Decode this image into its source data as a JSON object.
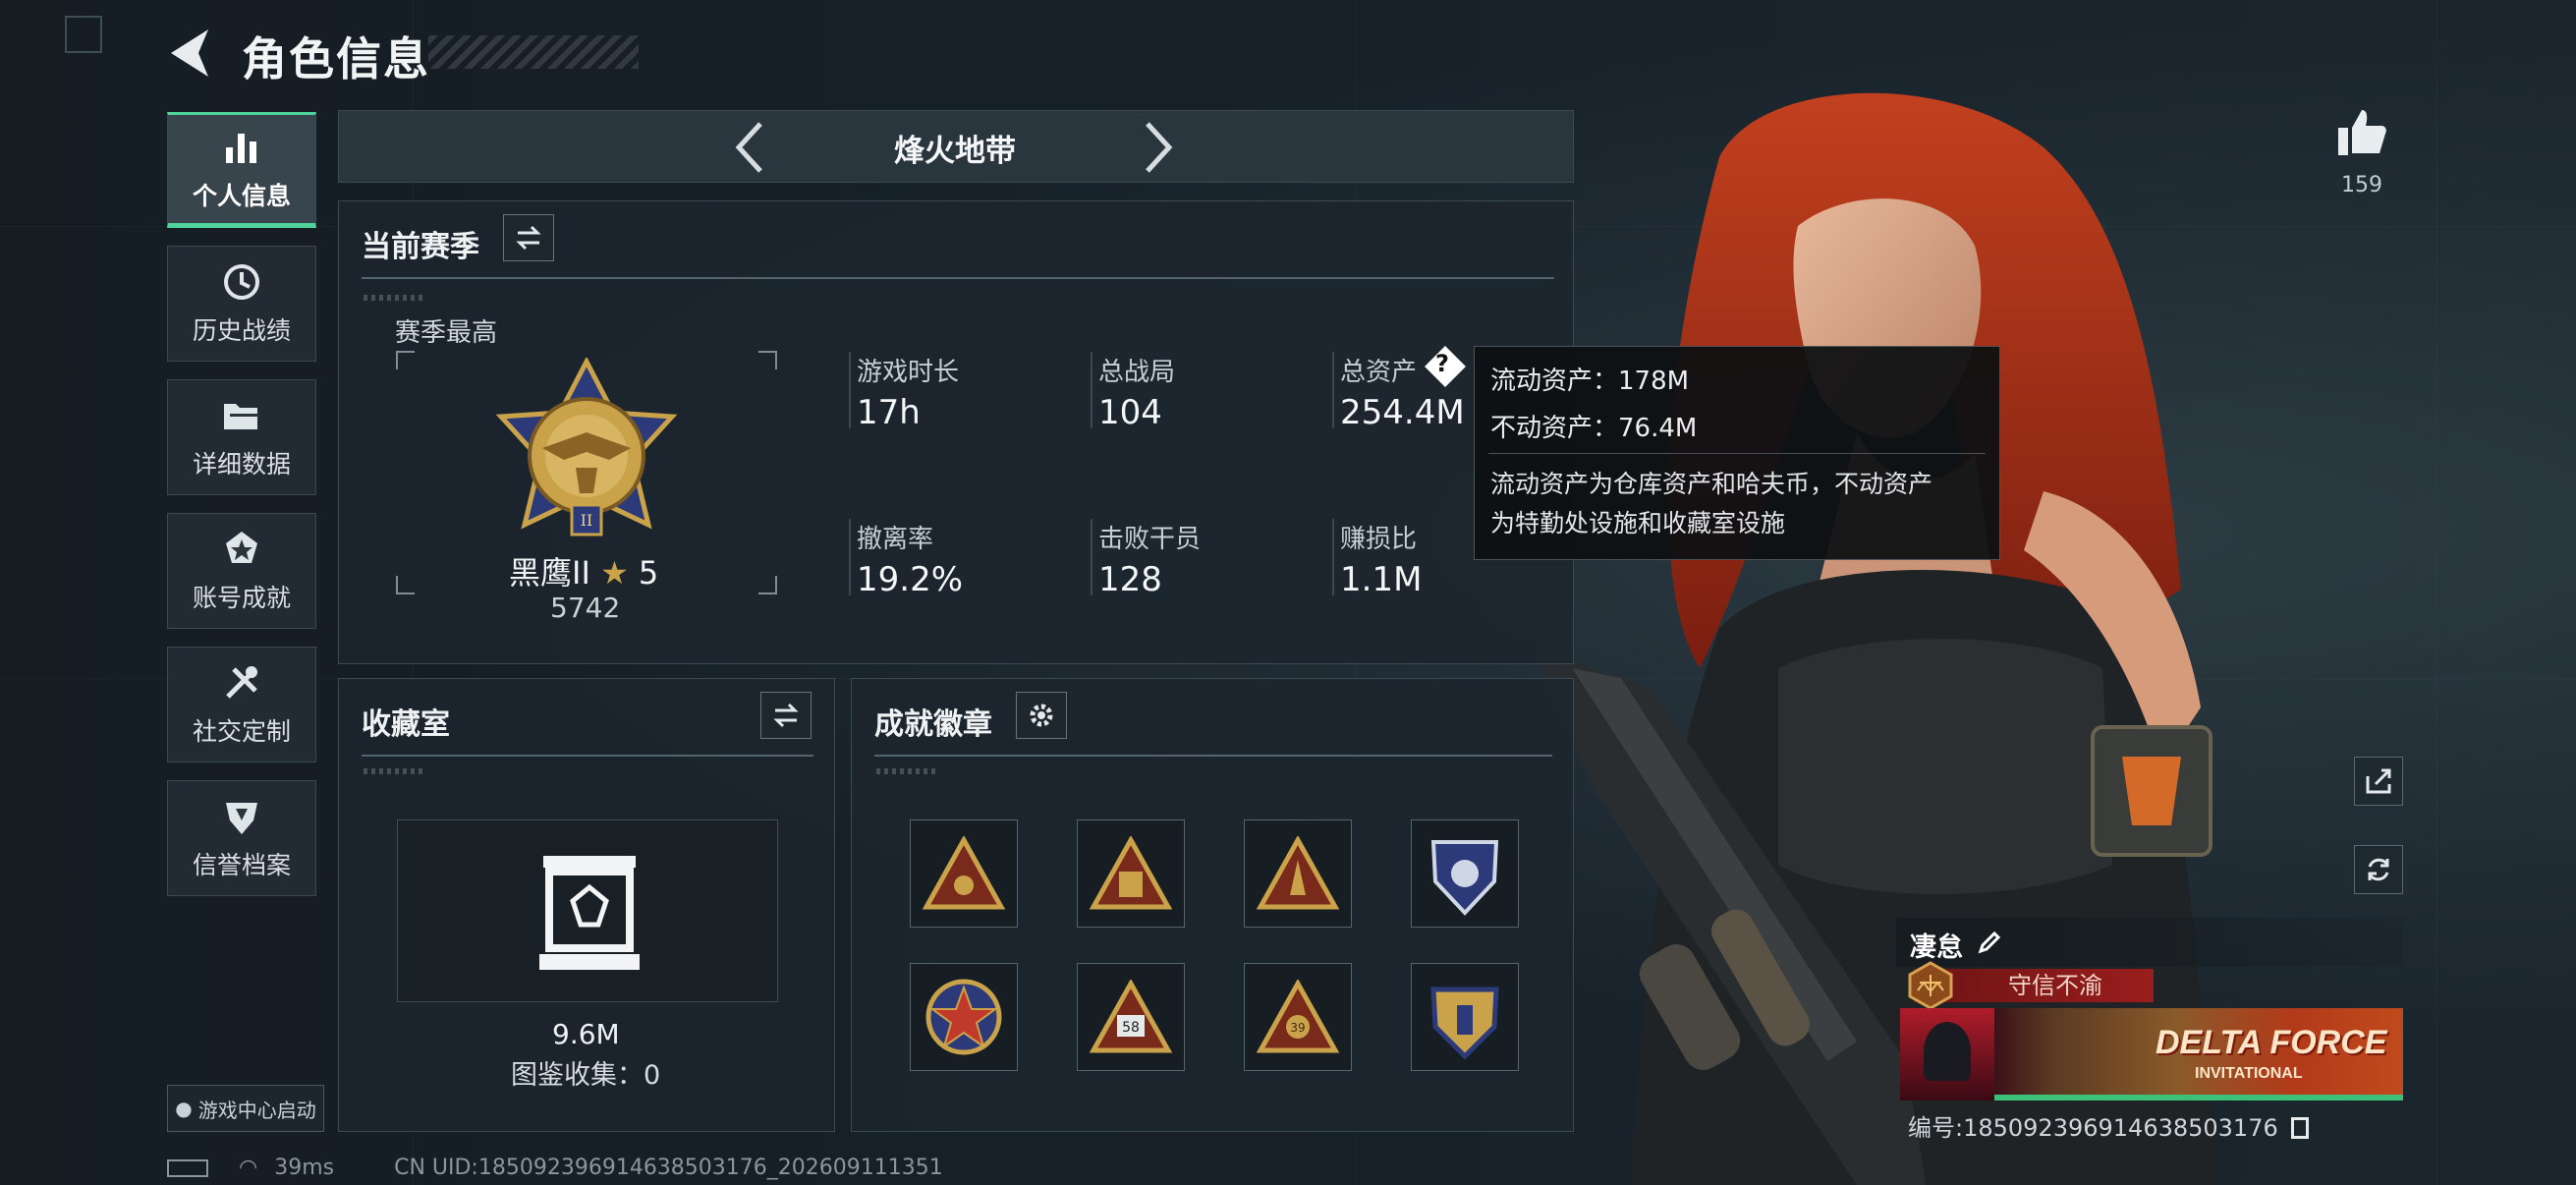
{
  "header": {
    "title": "角色信息"
  },
  "sidebar": {
    "items": [
      {
        "label": "个人信息",
        "icon": "bar-chart-icon",
        "active": true
      },
      {
        "label": "历史战绩",
        "icon": "clock-icon"
      },
      {
        "label": "详细数据",
        "icon": "folder-icon"
      },
      {
        "label": "账号成就",
        "icon": "medal-icon"
      },
      {
        "label": "社交定制",
        "icon": "tools-icon"
      },
      {
        "label": "信誉档案",
        "icon": "shield-icon"
      }
    ],
    "launch_button": "游戏中心启动"
  },
  "mode": {
    "name": "烽火地带"
  },
  "season": {
    "title": "当前赛季",
    "best_label": "赛季最高",
    "rank_name": "黑鹰II",
    "rank_stars": "5",
    "rank_score": "5742",
    "stats": [
      {
        "label": "游戏时长",
        "value": "17h"
      },
      {
        "label": "总战局",
        "value": "104"
      },
      {
        "label": "总资产",
        "value": "254.4M"
      },
      {
        "label": "撤离率",
        "value": "19.2%"
      },
      {
        "label": "击败干员",
        "value": "128"
      },
      {
        "label": "赚损比",
        "value": "1.1M"
      }
    ]
  },
  "tooltip": {
    "line1": "流动资产：178M",
    "line2": "不动资产：76.4M",
    "note_line1": "流动资产为仓库资产和哈夫币，不动资产",
    "note_line2": "为特勤处设施和收藏室设施"
  },
  "collection": {
    "title": "收藏室",
    "value": "9.6M",
    "catalog_label": "图鉴收集：0"
  },
  "achievements": {
    "title": "成就徽章",
    "badges": [
      "triangle-eye-badge",
      "triangle-soldiers-badge",
      "triangle-rocket-badge",
      "shield-eagle-badge",
      "star-circle-badge",
      "triangle-58-badge",
      "triangle-39-badge",
      "shield-gold-badge"
    ]
  },
  "right": {
    "likes": "159",
    "player_name": "凄怠",
    "motto": "守信不渝",
    "banner_text": "DELTA FORCE",
    "banner_subtext": "INVITATIONAL",
    "player_id": "编号:185092396914638503176"
  },
  "status": {
    "ping": "39ms",
    "uid": "CN UID:185092396914638503176_202609111351"
  },
  "colors": {
    "accent": "#4fd39a",
    "panel": "#1c262e",
    "motto": "#9a1d1d",
    "gold": "#c9a24a"
  }
}
